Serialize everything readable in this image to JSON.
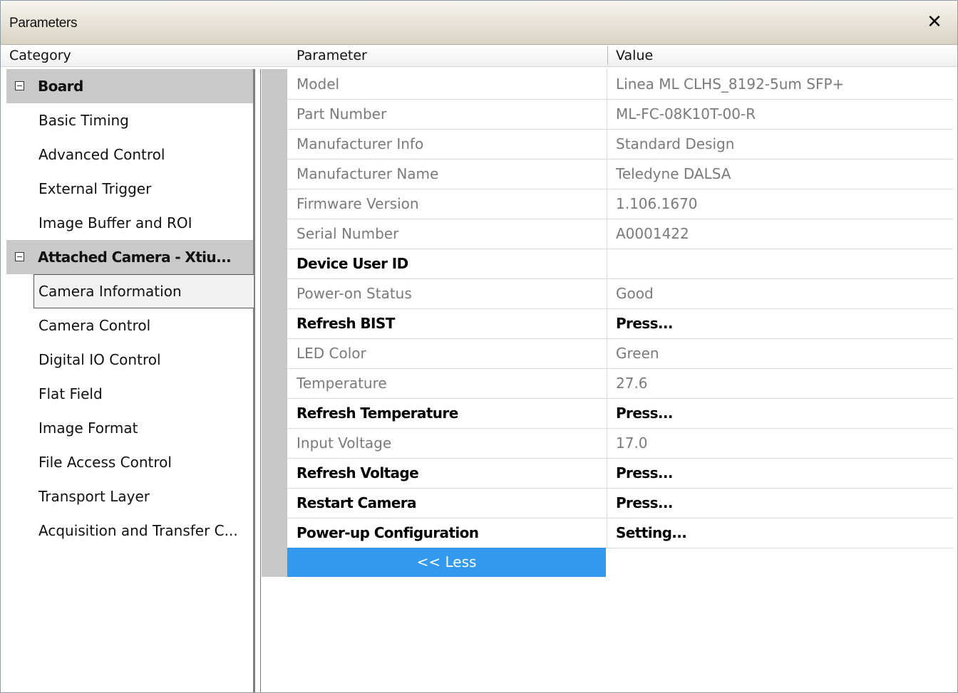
{
  "window": {
    "title": "Parameters",
    "close_label": "✕"
  },
  "header": {
    "category": "Category",
    "parameter": "Parameter",
    "value": "Value"
  },
  "categories": [
    {
      "label": "Board",
      "type": "group"
    },
    {
      "label": "Basic Timing",
      "type": "item"
    },
    {
      "label": "Advanced Control",
      "type": "item"
    },
    {
      "label": "External Trigger",
      "type": "item"
    },
    {
      "label": "Image Buffer and ROI",
      "type": "item"
    },
    {
      "label": "Attached Camera - Xtiu...",
      "type": "group"
    },
    {
      "label": "Camera Information",
      "type": "item",
      "selected": true
    },
    {
      "label": "Camera Control",
      "type": "item"
    },
    {
      "label": "Digital IO Control",
      "type": "item"
    },
    {
      "label": "Flat Field",
      "type": "item"
    },
    {
      "label": "Image Format",
      "type": "item"
    },
    {
      "label": "File Access Control",
      "type": "item"
    },
    {
      "label": "Transport Layer",
      "type": "item"
    },
    {
      "label": "Acquisition and Transfer C...",
      "type": "item"
    }
  ],
  "parameters": [
    {
      "name": "Model",
      "value": "Linea ML CLHS_8192-5um SFP+",
      "editable": false
    },
    {
      "name": "Part Number",
      "value": "ML-FC-08K10T-00-R",
      "editable": false
    },
    {
      "name": "Manufacturer Info",
      "value": "Standard Design",
      "editable": false
    },
    {
      "name": "Manufacturer Name",
      "value": "Teledyne DALSA",
      "editable": false
    },
    {
      "name": "Firmware Version",
      "value": "1.106.1670",
      "editable": false
    },
    {
      "name": "Serial Number",
      "value": "A0001422",
      "editable": false
    },
    {
      "name": "Device User ID",
      "value": "",
      "editable": true
    },
    {
      "name": "Power-on Status",
      "value": "Good",
      "editable": false
    },
    {
      "name": "Refresh BIST",
      "value": "Press...",
      "editable": true
    },
    {
      "name": "LED Color",
      "value": "Green",
      "editable": false
    },
    {
      "name": "Temperature",
      "value": "27.6",
      "editable": false
    },
    {
      "name": "Refresh Temperature",
      "value": "Press...",
      "editable": true
    },
    {
      "name": "Input Voltage",
      "value": "17.0",
      "editable": false
    },
    {
      "name": "Refresh Voltage",
      "value": "Press...",
      "editable": true
    },
    {
      "name": "Restart Camera",
      "value": "Press...",
      "editable": true
    },
    {
      "name": "Power-up Configuration",
      "value": "Setting...",
      "editable": true
    }
  ],
  "less_button": "<< Less",
  "colors": {
    "accent": "#3399ee",
    "group_bg": "#c9c9c9",
    "readonly_text": "#7a7a7a"
  }
}
